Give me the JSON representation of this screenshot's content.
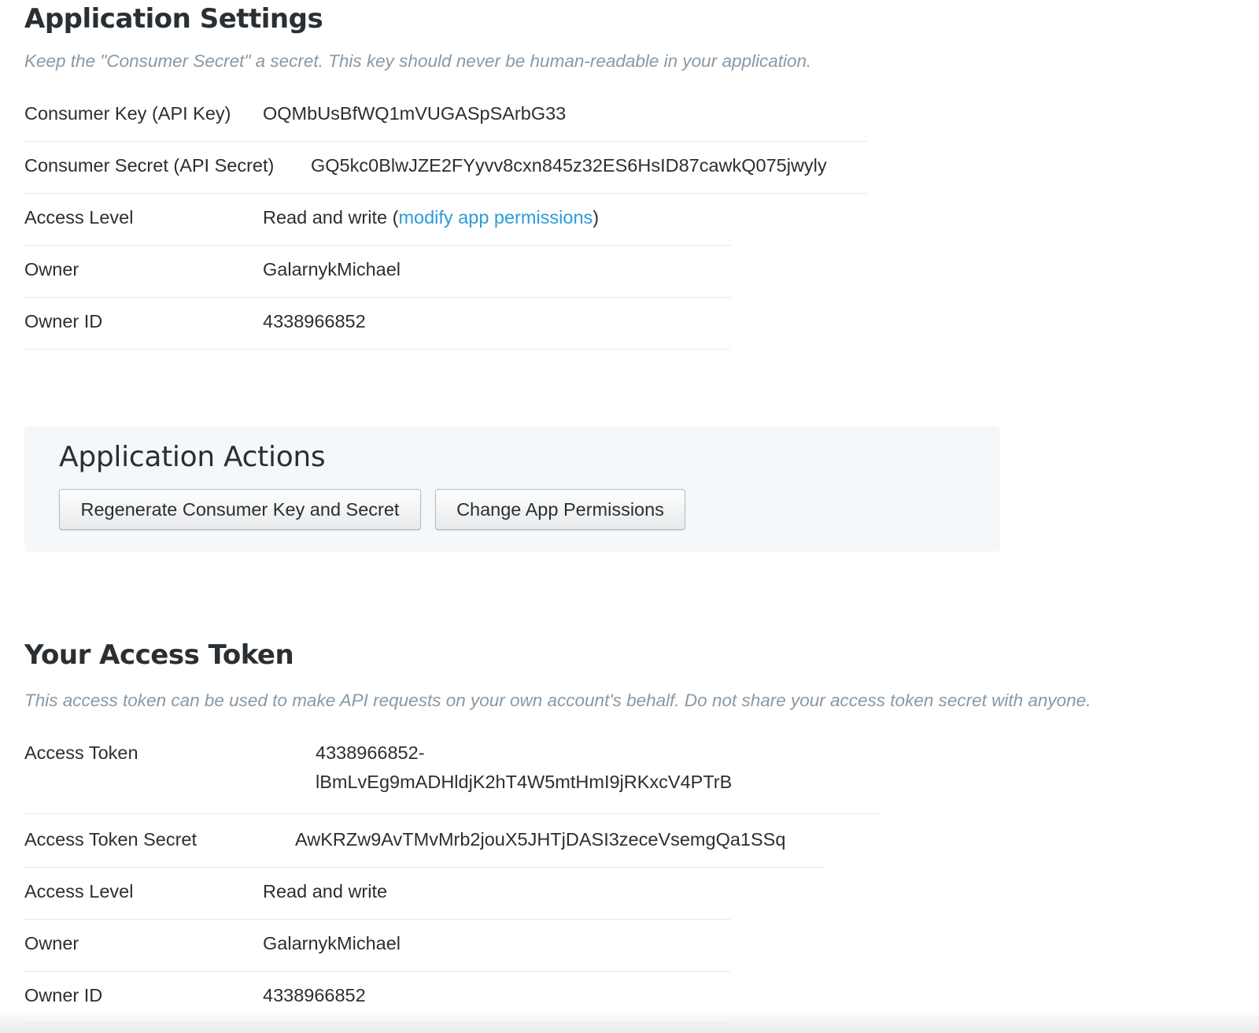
{
  "app_settings": {
    "title": "Application Settings",
    "description": "Keep the \"Consumer Secret\" a secret. This key should never be human-readable in your application.",
    "rows": [
      {
        "label": "Consumer Key (API Key)",
        "value": "OQMbUsBfWQ1mVUGASpSArbG33"
      },
      {
        "label": "Consumer Secret (API Secret)",
        "value": "GQ5kc0BlwJZE2FYyvv8cxn845z32ES6HsID87cawkQ075jwyly"
      },
      {
        "label": "Access Level",
        "value": "Read and write",
        "link_text": "modify app permissions"
      },
      {
        "label": "Owner",
        "value": "GalarnykMichael"
      },
      {
        "label": "Owner ID",
        "value": "4338966852"
      }
    ]
  },
  "app_actions": {
    "title": "Application Actions",
    "regenerate_label": "Regenerate Consumer Key and Secret",
    "change_permissions_label": "Change App Permissions"
  },
  "access_token": {
    "title": "Your Access Token",
    "description": "This access token can be used to make API requests on your own account's behalf. Do not share your access token secret with anyone.",
    "rows": [
      {
        "label": "Access Token",
        "value_line1": "4338966852-",
        "value_line2": "lBmLvEg9mADHldjK2hT4W5mtHmI9jRKxcV4PTrB"
      },
      {
        "label": "Access Token Secret",
        "value": "AwKRZw9AvTMvMrb2jouX5JHTjDASI3zeceVsemgQa1SSq"
      },
      {
        "label": "Access Level",
        "value": "Read and write"
      },
      {
        "label": "Owner",
        "value": "GalarnykMichael"
      },
      {
        "label": "Owner ID",
        "value": "4338966852"
      }
    ]
  },
  "colors": {
    "link": "#2b9bd8",
    "text": "#292f33",
    "muted": "#8899a6",
    "divider": "#e1e8ed",
    "panel": "#f5f8fa"
  }
}
